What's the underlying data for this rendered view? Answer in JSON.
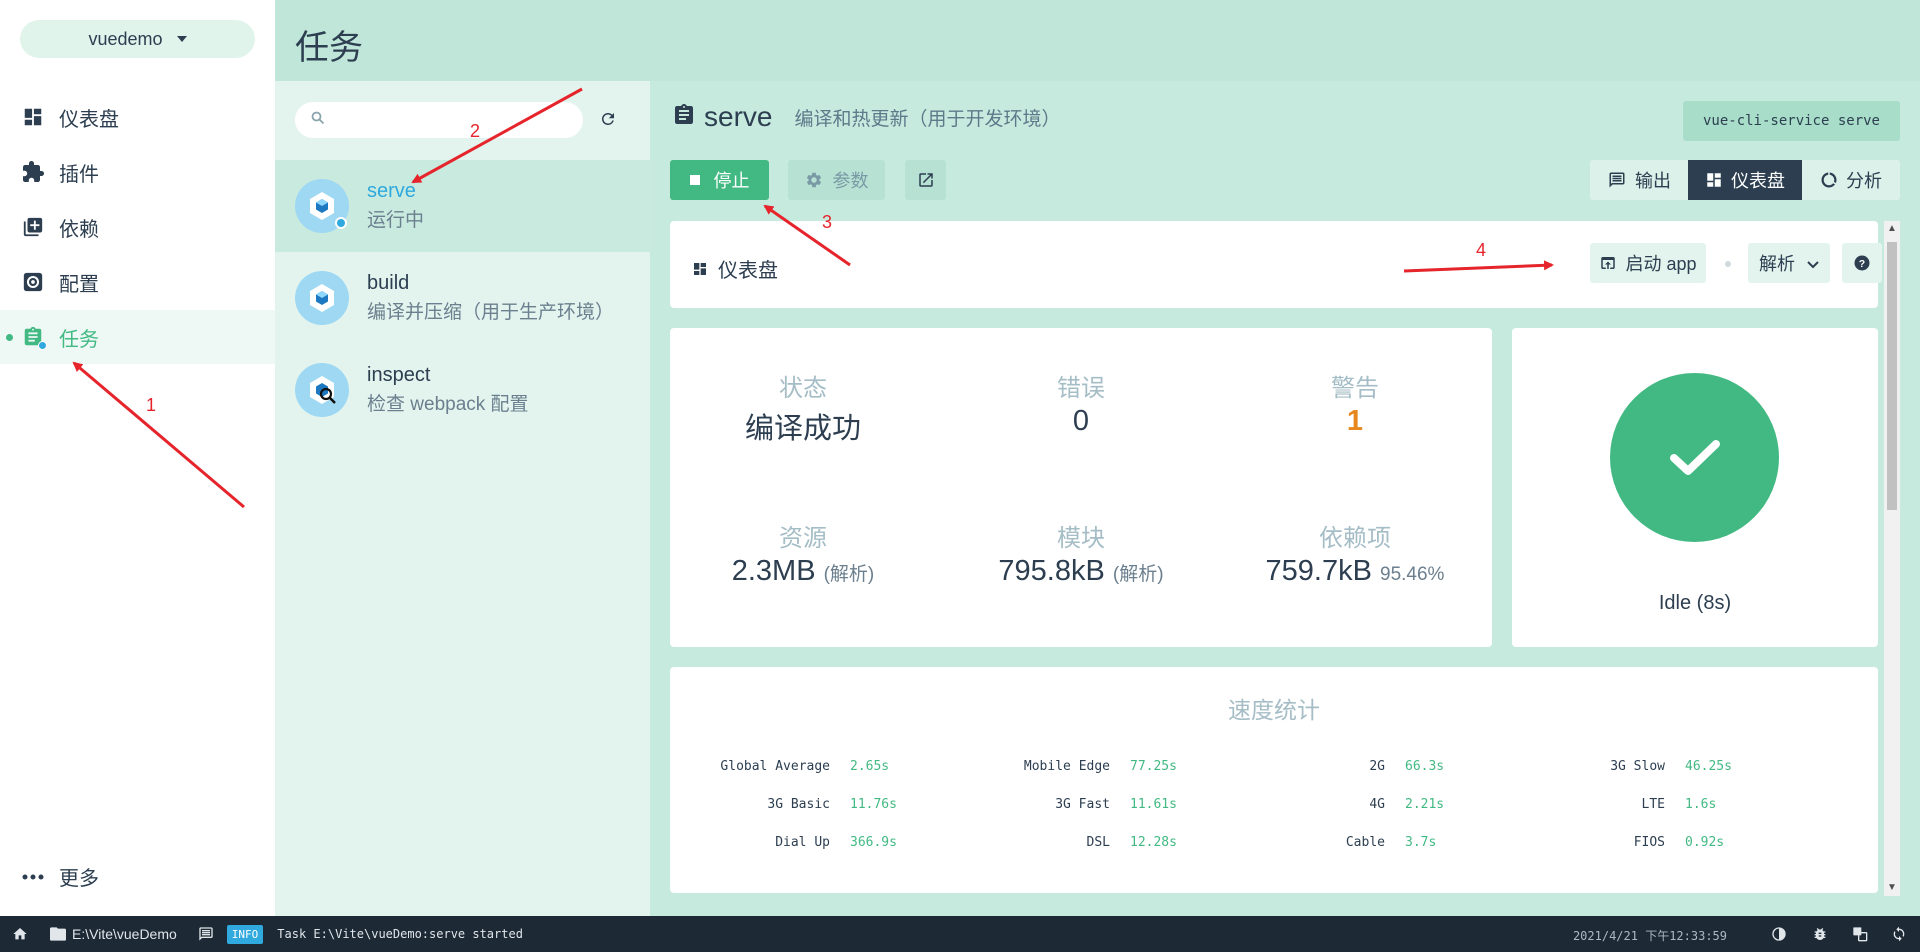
{
  "project": {
    "name": "vuedemo"
  },
  "nav": {
    "items": [
      {
        "label": "仪表盘",
        "icon": "dashboard-icon"
      },
      {
        "label": "插件",
        "icon": "puzzle-icon"
      },
      {
        "label": "依赖",
        "icon": "library-books-icon"
      },
      {
        "label": "配置",
        "icon": "settings-icon"
      },
      {
        "label": "任务",
        "icon": "assignment-icon"
      }
    ],
    "active": "任务",
    "more": "更多"
  },
  "header": {
    "title": "任务"
  },
  "task_list": {
    "search_placeholder": "",
    "tasks": [
      {
        "name": "serve",
        "desc": "运行中"
      },
      {
        "name": "build",
        "desc": "编译并压缩（用于生产环境）"
      },
      {
        "name": "inspect",
        "desc": "检查 webpack 配置"
      }
    ]
  },
  "task": {
    "name": "serve",
    "description": "编译和热更新（用于开发环境）",
    "command": "vue-cli-service serve"
  },
  "toolbar": {
    "stop": "停止",
    "params": "参数",
    "views": [
      "输出",
      "仪表盘",
      "分析"
    ],
    "active_view": "仪表盘"
  },
  "dashboard": {
    "label": "仪表盘",
    "launch_app": "启动 app",
    "parse": "解析"
  },
  "stats": {
    "status_label": "状态",
    "status_value": "编译成功",
    "errors_label": "错误",
    "errors_value": "0",
    "warnings_label": "警告",
    "warnings_value": "1",
    "assets_label": "资源",
    "assets_value": "2.3MB",
    "assets_note": "(解析)",
    "modules_label": "模块",
    "modules_value": "795.8kB",
    "modules_note": "(解析)",
    "deps_label": "依赖项",
    "deps_value": "759.7kB",
    "deps_note": "95.46%"
  },
  "build_status": {
    "text": "Idle (8s)"
  },
  "speed": {
    "title": "速度统计",
    "rows": [
      [
        [
          "Global Average",
          "2.65s"
        ],
        [
          "Mobile Edge",
          "77.25s"
        ],
        [
          "2G",
          "66.3s"
        ],
        [
          "3G Slow",
          "46.25s"
        ]
      ],
      [
        [
          "3G Basic",
          "11.76s"
        ],
        [
          "3G Fast",
          "11.61s"
        ],
        [
          "4G",
          "2.21s"
        ],
        [
          "LTE",
          "1.6s"
        ]
      ],
      [
        [
          "Dial Up",
          "366.9s"
        ],
        [
          "DSL",
          "12.28s"
        ],
        [
          "Cable",
          "3.7s"
        ],
        [
          "FIOS",
          "0.92s"
        ]
      ]
    ]
  },
  "statusbar": {
    "path": "E:\\Vite\\vueDemo",
    "level": "INFO",
    "log": "Task E:\\Vite\\vueDemo:serve started",
    "time": "2021/4/21 下午12:33:59"
  },
  "annotations": [
    "1",
    "2",
    "3",
    "4"
  ],
  "colors": {
    "accent": "#42b983",
    "header": "#bfe6d8",
    "dark": "#2c3e50",
    "warning": "#e8871e",
    "annotation": "#e5242b"
  }
}
